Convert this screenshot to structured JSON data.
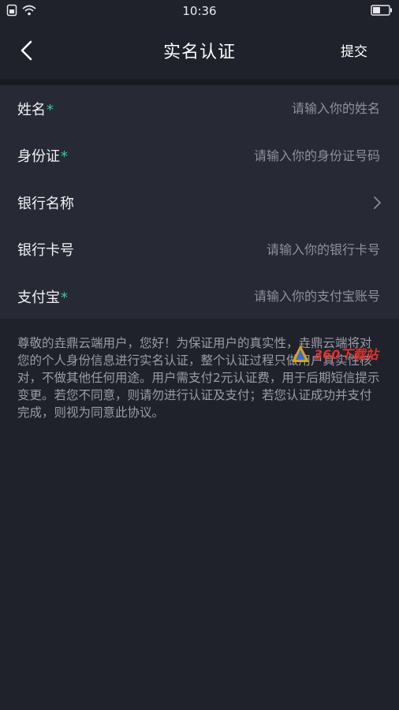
{
  "status_bar": {
    "time": "10:36"
  },
  "header": {
    "title": "实名认证",
    "submit_label": "提交"
  },
  "form": {
    "rows": [
      {
        "label": "姓名",
        "required": "*",
        "placeholder": "请输入你的姓名"
      },
      {
        "label": "身份证",
        "required": "*",
        "placeholder": "请输入你的身份证号码"
      },
      {
        "label": "银行名称"
      },
      {
        "label": "银行卡号",
        "placeholder": "请输入你的银行卡号"
      },
      {
        "label": "支付宝",
        "required": "*",
        "placeholder": "请输入你的支付宝账号"
      }
    ]
  },
  "notice": "尊敬的垚鼎云端用户，您好！为保证用户的真实性，垚鼎云端将对您的个人身份信息进行实名认证，整个认证过程只做用户真实性核对，不做其他任何用途。用户需支付2元认证费，用于后期短信提示变更。若您不同意，则请勿进行认证及支付；若您认证成功并支付完成，则视为同意此协议。",
  "watermark": {
    "text": "360下载站"
  },
  "colors": {
    "background": "#20222b",
    "panel": "#272a34",
    "required": "#2fd09a",
    "placeholder": "#8e909a"
  }
}
